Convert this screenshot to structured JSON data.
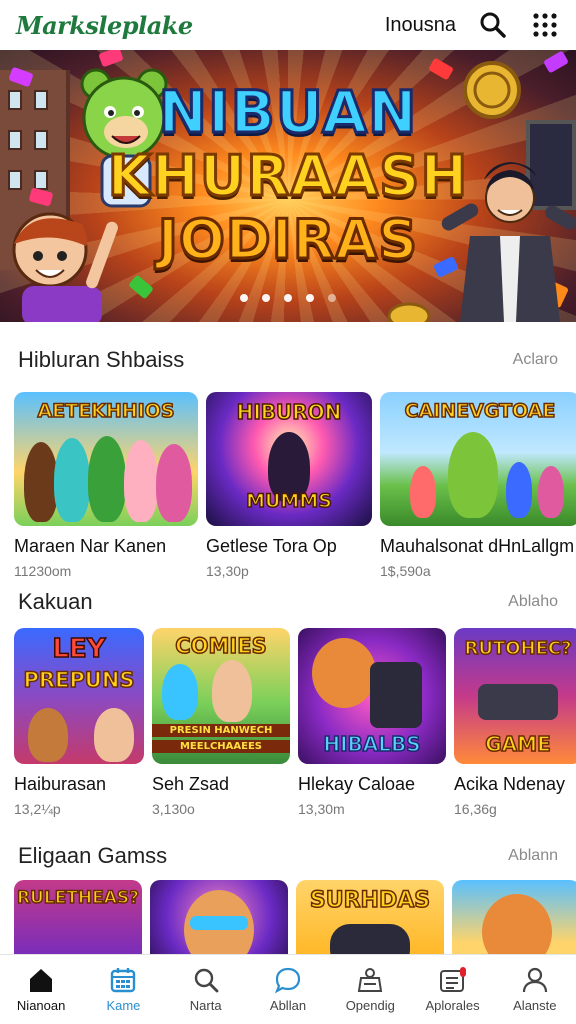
{
  "header": {
    "logo": "Marksleplake",
    "link": "Inousna",
    "search_icon": "search-icon",
    "menu_icon": "grid-dots-icon"
  },
  "banner": {
    "line1": "NIBUAN",
    "line2": "KHURAASH",
    "line3": "JODIRAS",
    "slides": 5,
    "active_slide": 0
  },
  "sections": [
    {
      "title": "Hibluran Shbaiss",
      "more": "Aclaro",
      "cards": [
        {
          "thumb_text": "AETEKHHIOS",
          "title": "Maraen Nar Kanen",
          "meta": "11230om"
        },
        {
          "thumb_text": "HIBURON",
          "thumb_text2": "MUMMS",
          "title": "Getlese Tora Op",
          "meta": "13,30p"
        },
        {
          "thumb_text": "CAINEVGTOAE",
          "title": "Mauhalsonat dHnLallgm",
          "meta": "1$,590a"
        }
      ]
    },
    {
      "title": "Kakuan",
      "more": "Ablaho",
      "cards": [
        {
          "thumb_text": "LEY",
          "thumb_text2": "PREPUNS",
          "title": "Haiburasan",
          "meta": "13,2¼p"
        },
        {
          "thumb_text": "COMIES",
          "thumb_text2": "PRESIN HANWECH",
          "thumb_text3": "MEELCHAAEES",
          "title": "Seh Zsad",
          "meta": "3,130o"
        },
        {
          "thumb_text": "HIBALBS",
          "title": "Hlekay Caloae",
          "meta": "13,30m"
        },
        {
          "thumb_text": "RUTOHEC?",
          "thumb_text2": "GAME",
          "title": "Acika Ndenay",
          "meta": "16,36g"
        }
      ]
    },
    {
      "title": "Eligaan Gamss",
      "more": "Ablann",
      "cards": [
        {
          "thumb_text": "RULETHEAS?"
        },
        {
          "thumb_text": ""
        },
        {
          "thumb_text": "SURHDAS"
        },
        {
          "thumb_text": ""
        }
      ]
    }
  ],
  "nav": [
    {
      "label": "Nianoan",
      "icon": "home-icon"
    },
    {
      "label": "Kame",
      "icon": "calendar-grid-icon"
    },
    {
      "label": "Narta",
      "icon": "search-icon"
    },
    {
      "label": "Abllan",
      "icon": "chat-bubble-icon"
    },
    {
      "label": "Opendig",
      "icon": "scale-icon"
    },
    {
      "label": "Aplorales",
      "icon": "apps-notification-icon"
    },
    {
      "label": "Alanste",
      "icon": "profile-icon"
    }
  ],
  "colors": {
    "brand": "#1f7a3e",
    "active_tab": "#2a8fd0",
    "notification": "#e0202a"
  }
}
